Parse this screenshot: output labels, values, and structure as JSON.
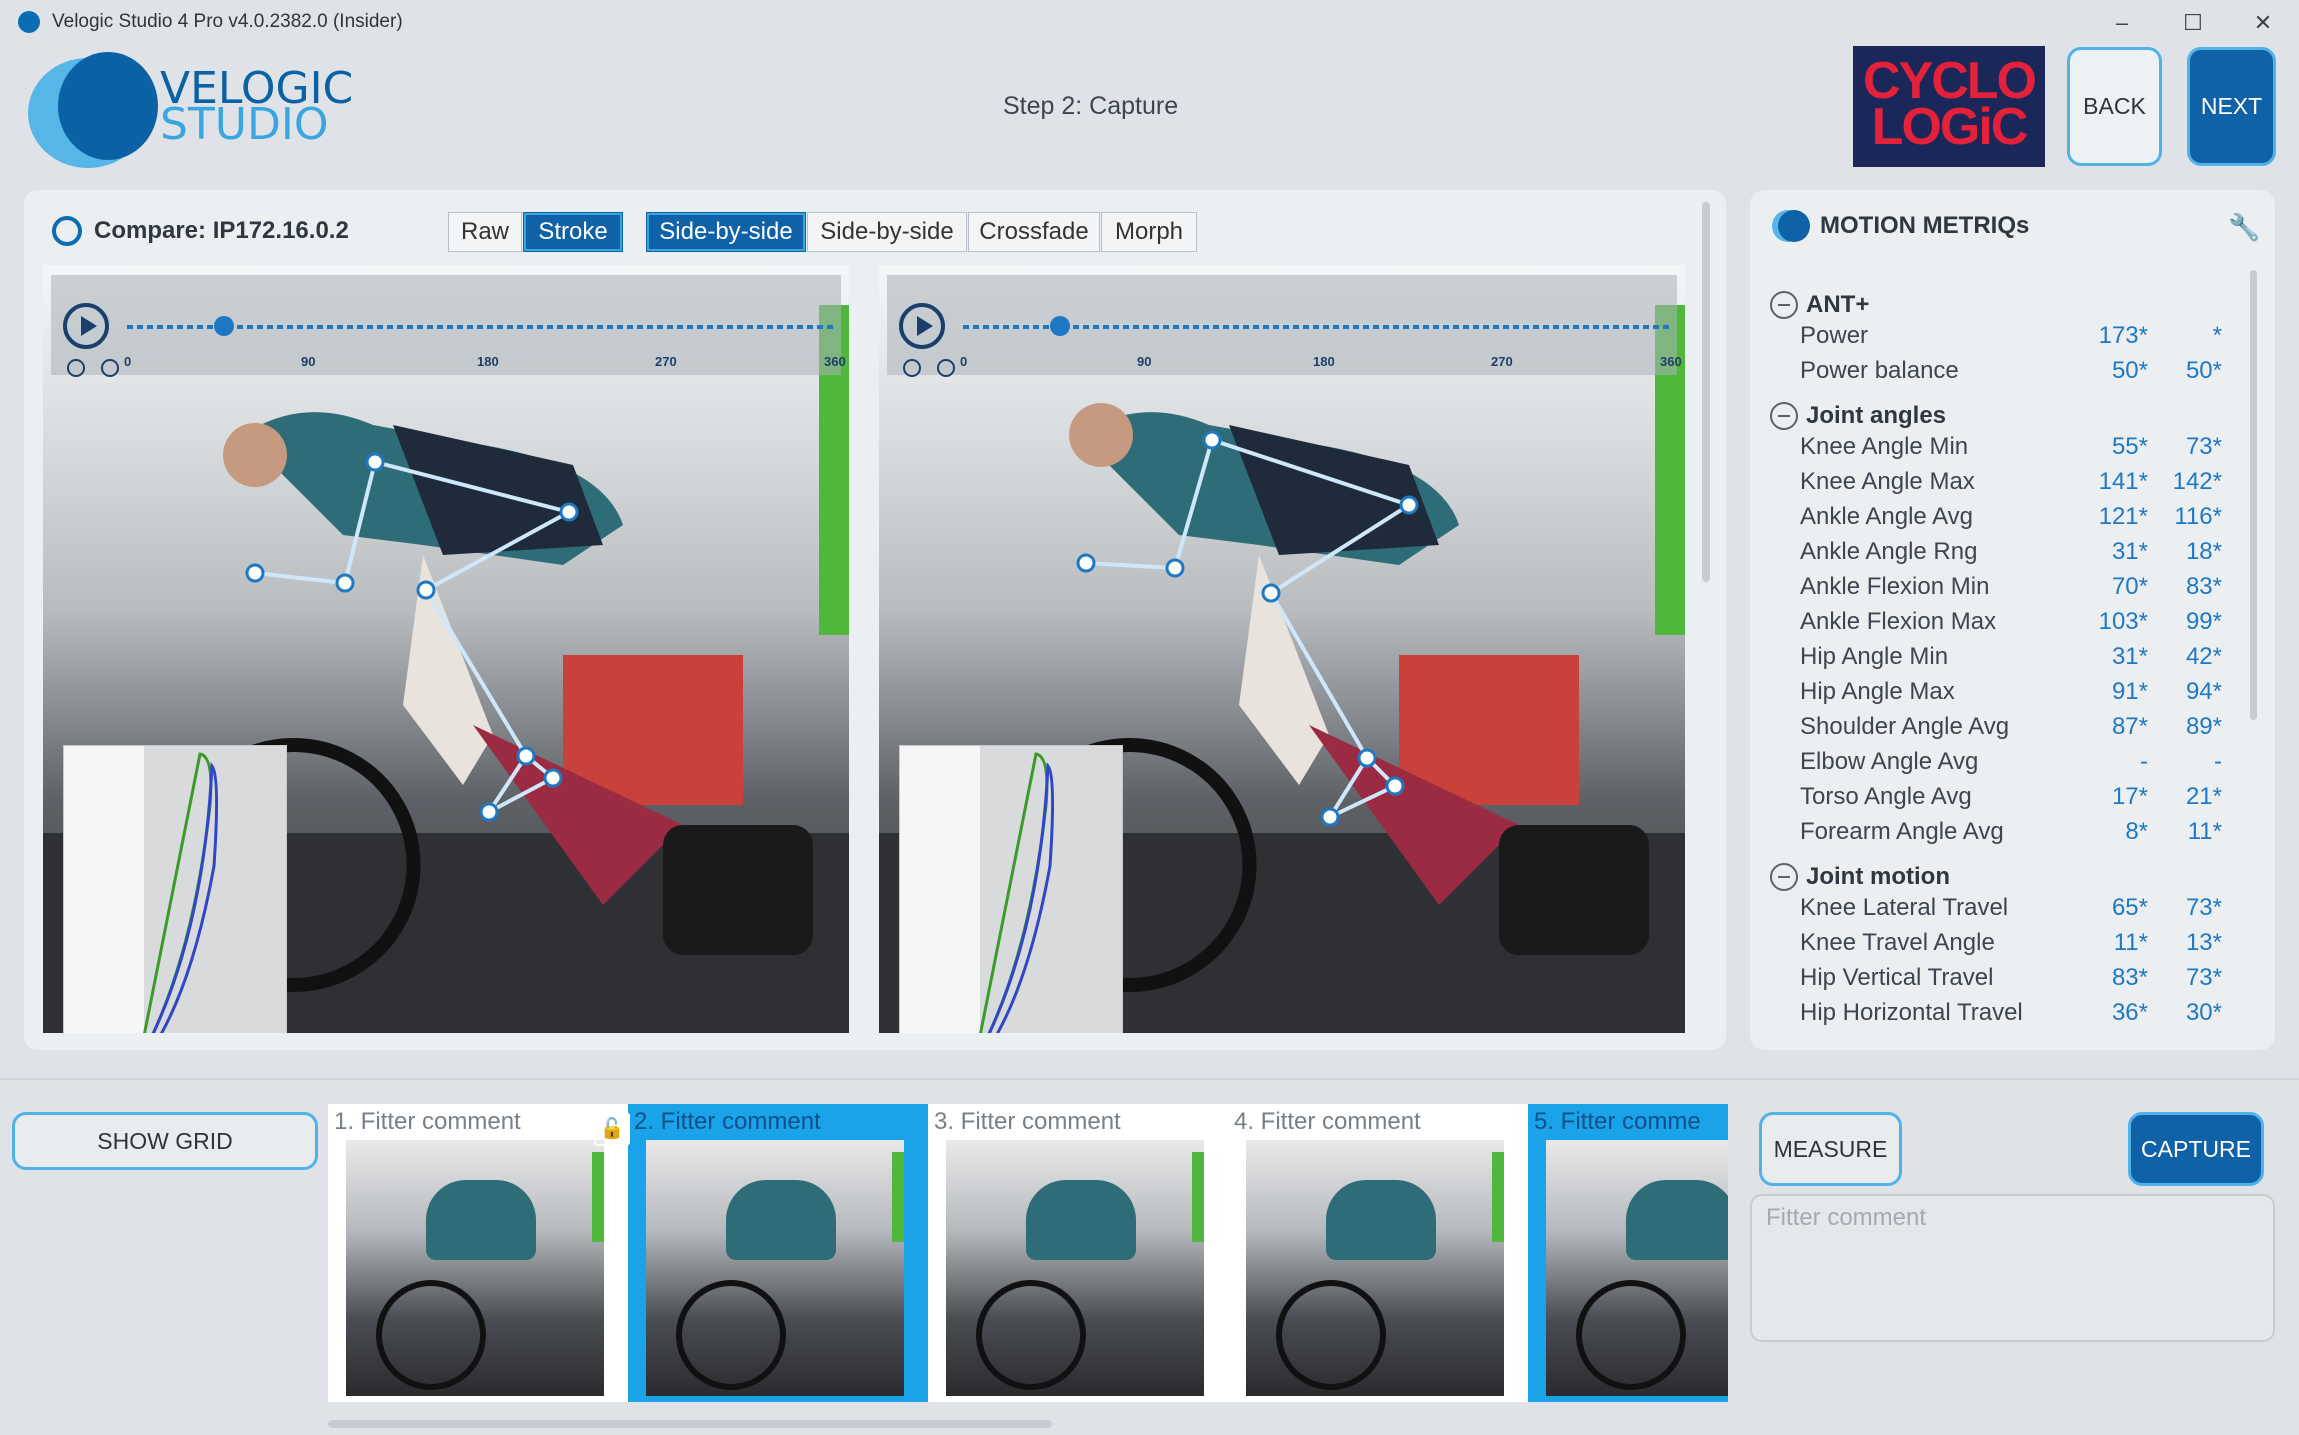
{
  "window": {
    "title": "Velogic Studio 4 Pro v4.0.2382.0 (Insider)",
    "controls": [
      "–",
      "☐",
      "✕"
    ]
  },
  "logo": {
    "line1": "VELOGIC",
    "line2": "STUDIO"
  },
  "header": {
    "step": "Step 2: Capture",
    "partner_logo": "CYCLO LOGiC",
    "back_label": "BACK",
    "next_label": "NEXT"
  },
  "compare": {
    "label": "Compare: IP172.16.0.2",
    "mode_buttons": [
      {
        "label": "Raw",
        "active": false
      },
      {
        "label": "Stroke",
        "active": true
      }
    ],
    "view_buttons": [
      {
        "label": "Side-by-side",
        "active": true
      },
      {
        "label": "Side-by-side",
        "active": false
      },
      {
        "label": "Crossfade",
        "active": false
      },
      {
        "label": "Morph",
        "active": false
      }
    ]
  },
  "videos": [
    {
      "ticks": [
        "0",
        "90",
        "180",
        "270",
        "360"
      ],
      "position_deg": 30
    },
    {
      "ticks": [
        "0",
        "90",
        "180",
        "270",
        "360"
      ],
      "position_deg": 30
    }
  ],
  "metrics": {
    "title": "MOTION METRIQs",
    "groups": [
      {
        "name": "ANT+",
        "rows": [
          {
            "name": "Power",
            "v1": "173*",
            "v2": "*"
          },
          {
            "name": "Power balance",
            "v1": "50*",
            "v2": "50*"
          }
        ]
      },
      {
        "name": "Joint angles",
        "rows": [
          {
            "name": "Knee Angle Min",
            "v1": "55*",
            "v2": "73*"
          },
          {
            "name": "Knee Angle Max",
            "v1": "141*",
            "v2": "142*"
          },
          {
            "name": "Ankle Angle Avg",
            "v1": "121*",
            "v2": "116*"
          },
          {
            "name": "Ankle Angle Rng",
            "v1": "31*",
            "v2": "18*"
          },
          {
            "name": "Ankle Flexion Min",
            "v1": "70*",
            "v2": "83*"
          },
          {
            "name": "Ankle Flexion Max",
            "v1": "103*",
            "v2": "99*"
          },
          {
            "name": "Hip Angle Min",
            "v1": "31*",
            "v2": "42*"
          },
          {
            "name": "Hip Angle Max",
            "v1": "91*",
            "v2": "94*"
          },
          {
            "name": "Shoulder Angle Avg",
            "v1": "87*",
            "v2": "89*"
          },
          {
            "name": "Elbow Angle Avg",
            "v1": "-",
            "v2": "-"
          },
          {
            "name": "Torso Angle Avg",
            "v1": "17*",
            "v2": "21*"
          },
          {
            "name": "Forearm Angle Avg",
            "v1": "8*",
            "v2": "11*"
          }
        ]
      },
      {
        "name": "Joint motion",
        "rows": [
          {
            "name": "Knee Lateral Travel",
            "v1": "65*",
            "v2": "73*"
          },
          {
            "name": "Knee Travel Angle",
            "v1": "11*",
            "v2": "13*"
          },
          {
            "name": "Hip Vertical Travel",
            "v1": "83*",
            "v2": "73*"
          },
          {
            "name": "Hip Horizontal Travel",
            "v1": "36*",
            "v2": "30*"
          }
        ]
      }
    ]
  },
  "bottom": {
    "show_grid_label": "SHOW GRID",
    "thumbnails": [
      {
        "caption": "1. Fitter comment",
        "selected": false
      },
      {
        "caption": "2. Fitter comment",
        "selected": true
      },
      {
        "caption": "3. Fitter comment",
        "selected": false
      },
      {
        "caption": "4. Fitter comment",
        "selected": false
      },
      {
        "caption": "5. Fitter comme",
        "selected": true
      }
    ],
    "measure_label": "MEASURE",
    "capture_label": "CAPTURE",
    "comment_placeholder": "Fitter comment"
  },
  "colors": {
    "accent": "#0f62a8",
    "accent_light": "#4fb3e8",
    "metric_value": "#1e78c4",
    "partner_logo_bg": "#1b2759",
    "partner_logo_text": "#e3213a"
  }
}
